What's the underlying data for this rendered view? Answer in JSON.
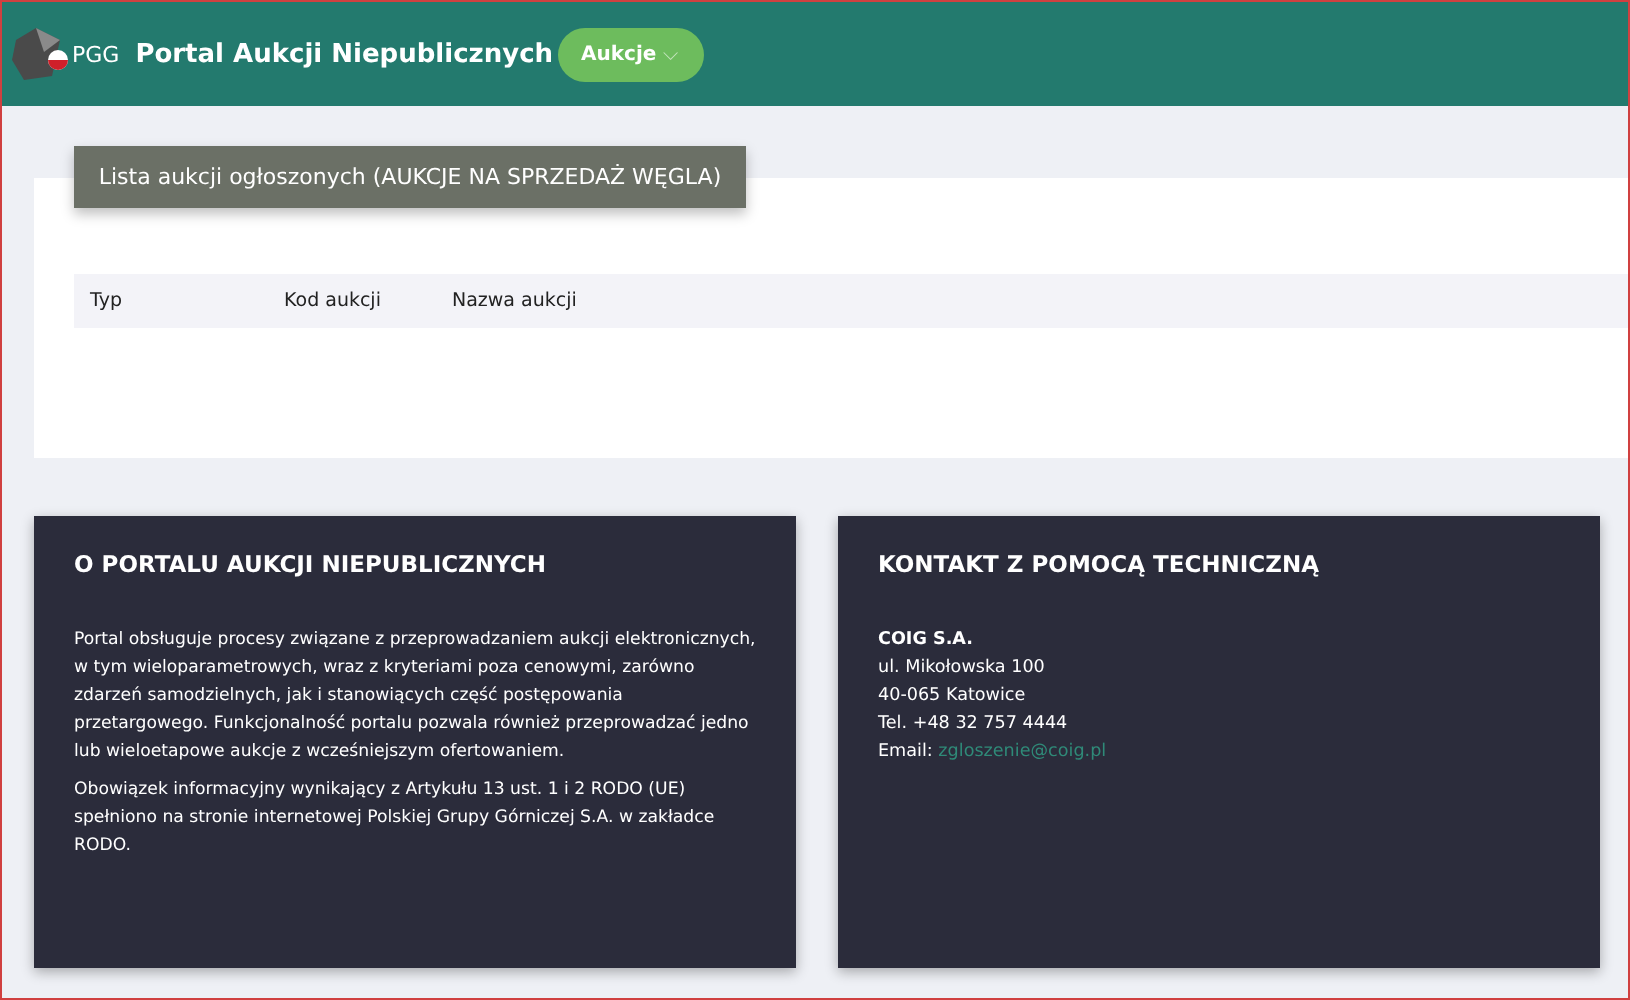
{
  "header": {
    "logo_text": "PGG",
    "title": "Portal Aukcji Niepublicznych",
    "menu_button": {
      "label": "Aukcje",
      "caret": "⌵"
    }
  },
  "auction_list": {
    "title": "Lista aukcji ogłoszonych (AUKCJE NA SPRZEDAŻ WĘGLA)",
    "columns": [
      "Typ",
      "Kod aukcji",
      "Nazwa aukcji"
    ]
  },
  "about": {
    "heading": "O PORTALU AUKCJI NIEPUBLICZNYCH",
    "paragraphs": [
      "Portal obsługuje procesy związane z przeprowadzaniem aukcji elektronicznych, w tym wieloparametrowych, wraz z kryteriami poza cenowymi, zarówno zdarzeń samodzielnych, jak i stanowiących część postępowania przetargowego. Funkcjonalność portalu pozwala również przeprowadzać jedno lub wieloetapowe aukcje z wcześniejszym ofertowaniem.",
      "Obowiązek informacyjny wynikający z Artykułu 13 ust. 1 i 2 RODO (UE) spełniono na stronie internetowej Polskiej Grupy Górniczej S.A. w zakładce RODO."
    ]
  },
  "contact": {
    "heading": "KONTAKT Z POMOCĄ TECHNICZNĄ",
    "company": "COIG S.A.",
    "lines": [
      "ul. Mikołowska 100",
      "40-065 Katowice",
      "Tel. +48 32 757 4444"
    ],
    "email_label": "Email:",
    "email": "zgloszenie@coig.pl"
  }
}
